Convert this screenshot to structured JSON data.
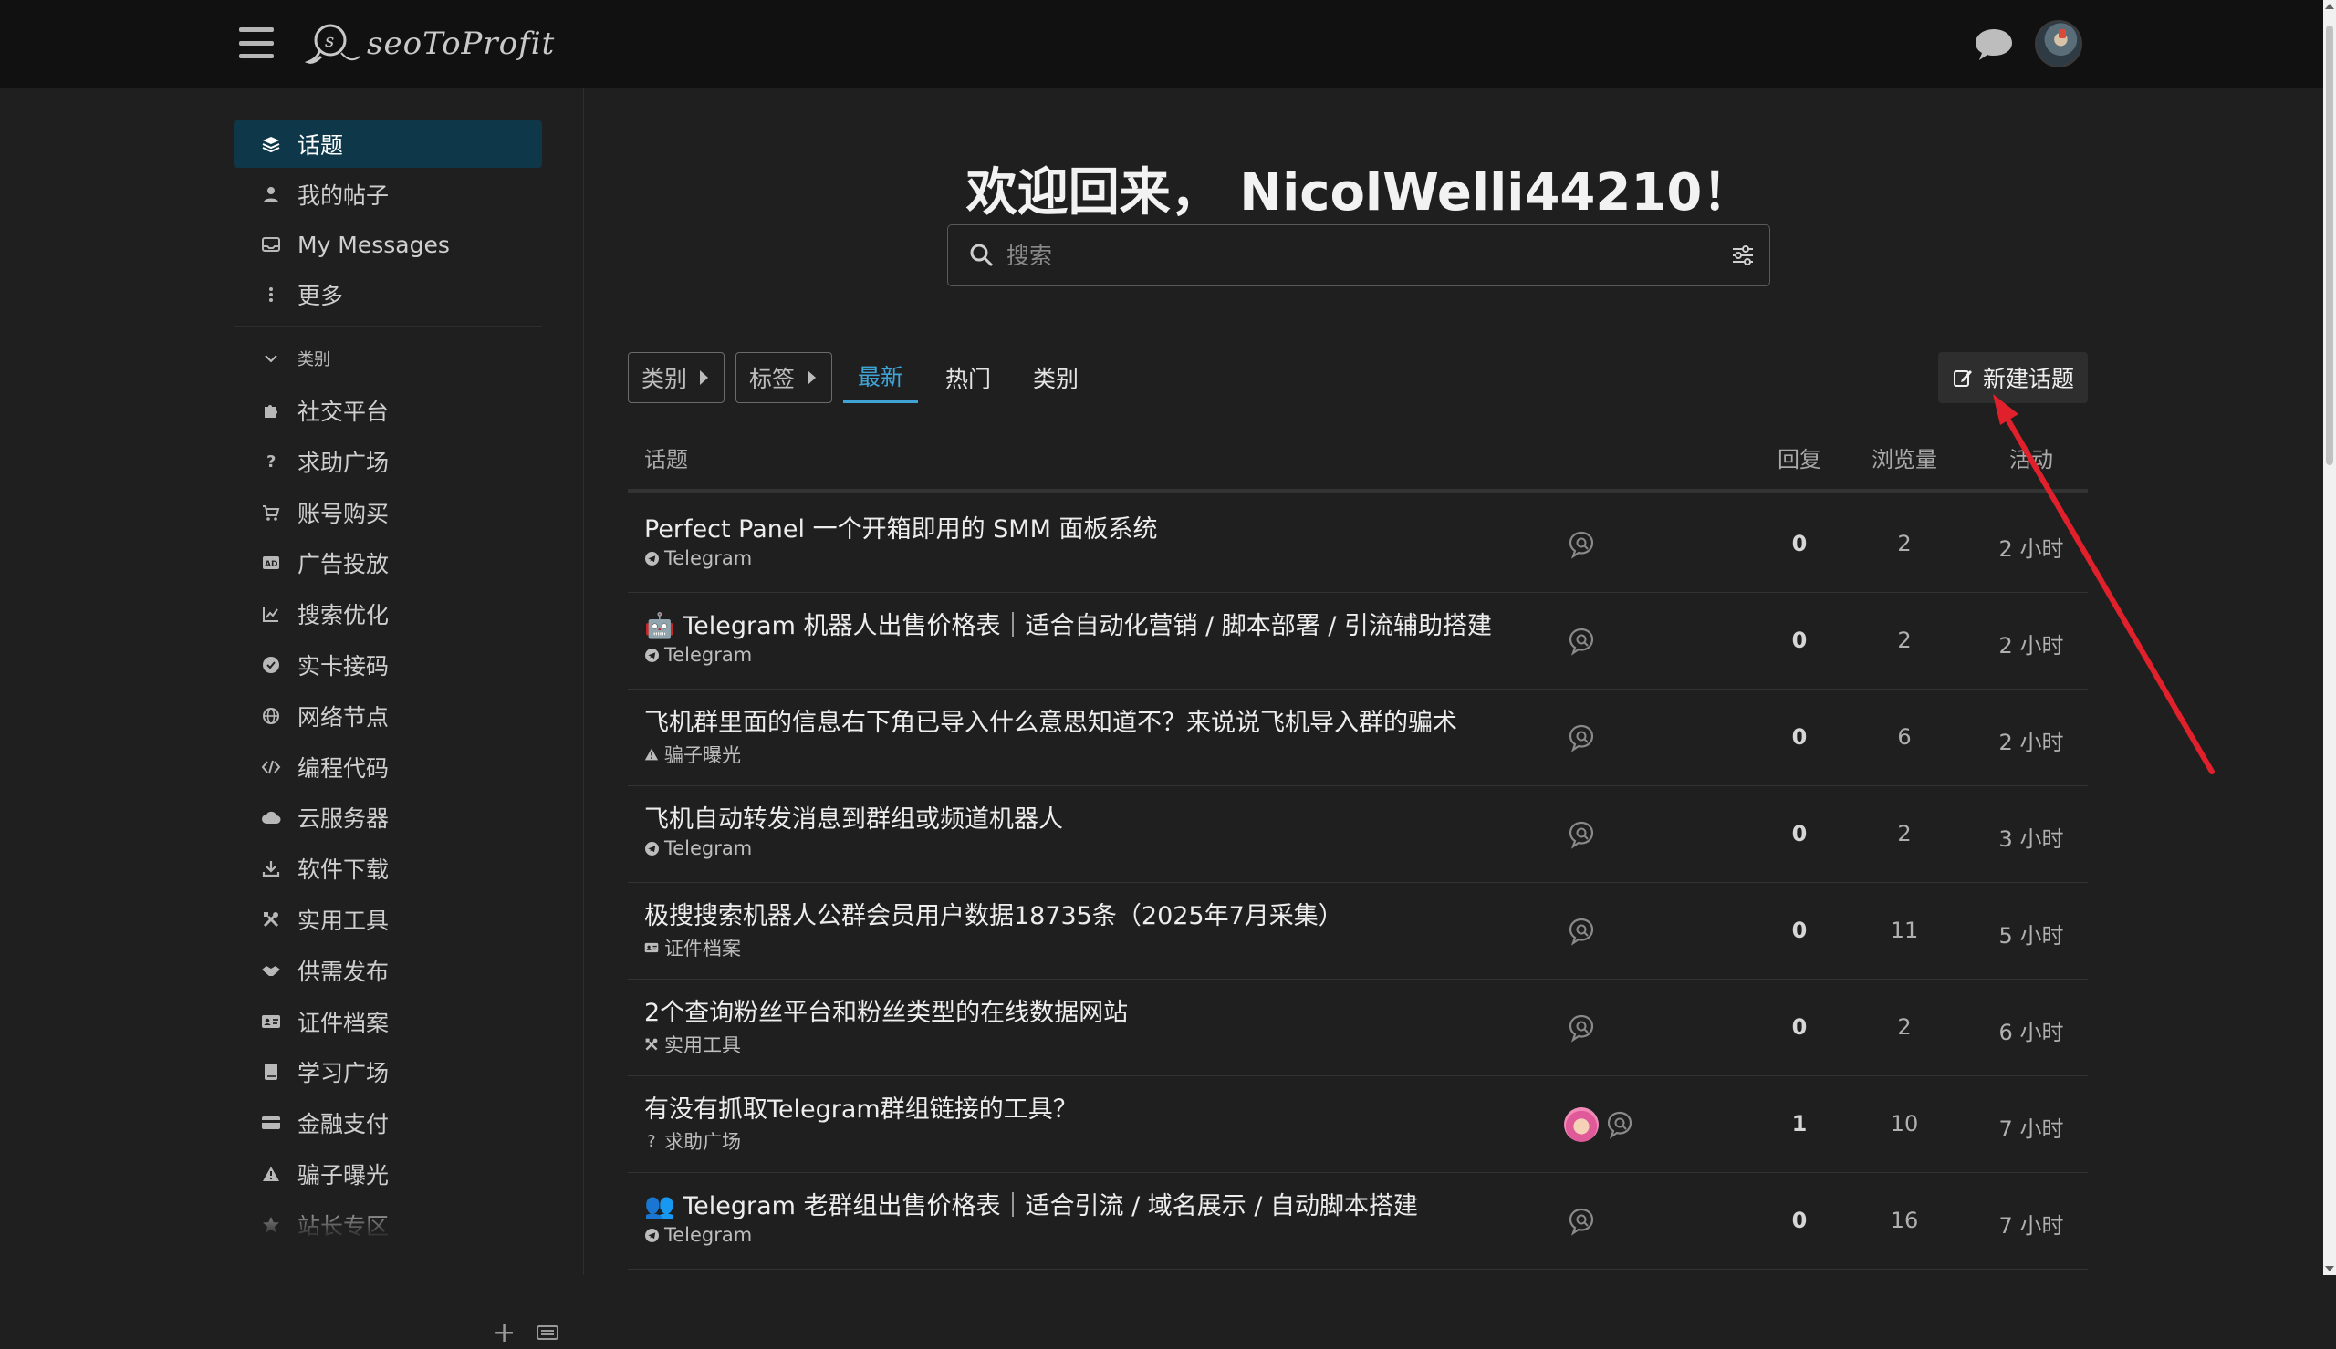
{
  "header": {
    "logo_text": "seoToProfit",
    "menu_icon": "hamburger-icon",
    "chat_icon": "chat-bubble-icon",
    "avatar": "user-avatar"
  },
  "sidebar": {
    "main_items": [
      {
        "label": "话题",
        "icon": "layers-icon",
        "active": true
      },
      {
        "label": "我的帖子",
        "icon": "user-icon"
      },
      {
        "label": "My Messages",
        "icon": "inbox-icon"
      },
      {
        "label": "更多",
        "icon": "more-vertical-icon"
      }
    ],
    "section_label": "类别",
    "categories": [
      {
        "label": "社交平台",
        "icon": "puzzle-icon"
      },
      {
        "label": "求助广场",
        "icon": "question-icon"
      },
      {
        "label": "账号购买",
        "icon": "cart-icon"
      },
      {
        "label": "广告投放",
        "icon": "ad-icon"
      },
      {
        "label": "搜索优化",
        "icon": "chart-line-icon"
      },
      {
        "label": "实卡接码",
        "icon": "check-circle-icon"
      },
      {
        "label": "网络节点",
        "icon": "globe-icon"
      },
      {
        "label": "编程代码",
        "icon": "code-icon"
      },
      {
        "label": "云服务器",
        "icon": "cloud-icon"
      },
      {
        "label": "软件下载",
        "icon": "download-icon"
      },
      {
        "label": "实用工具",
        "icon": "tools-icon"
      },
      {
        "label": "供需发布",
        "icon": "handshake-icon"
      },
      {
        "label": "证件档案",
        "icon": "id-card-icon"
      },
      {
        "label": "学习广场",
        "icon": "book-icon"
      },
      {
        "label": "金融支付",
        "icon": "credit-card-icon"
      },
      {
        "label": "骗子曝光",
        "icon": "warning-icon"
      },
      {
        "label": "站长专区",
        "icon": "star-icon"
      }
    ]
  },
  "main": {
    "welcome": "欢迎回来， NicolWelli44210！",
    "search_placeholder": "搜索",
    "filters": {
      "category_dropdown": "类别",
      "tag_dropdown": "标签"
    },
    "tabs": [
      {
        "label": "最新",
        "active": true
      },
      {
        "label": "热门"
      },
      {
        "label": "类别"
      }
    ],
    "new_topic_label": "新建话题",
    "columns": {
      "topic": "话题",
      "replies": "回复",
      "views": "浏览量",
      "activity": "活动"
    },
    "topics": [
      {
        "title": "Perfect Panel 一个开箱即用的 SMM 面板系统",
        "category": "Telegram",
        "cat_icon": "telegram-icon",
        "replies": "0",
        "views": "2",
        "activity": "2 小时"
      },
      {
        "title": "🤖 Telegram 机器人出售价格表｜适合自动化营销 / 脚本部署 / 引流辅助搭建",
        "category": "Telegram",
        "cat_icon": "telegram-icon",
        "replies": "0",
        "views": "2",
        "activity": "2 小时"
      },
      {
        "title": "飞机群里面的信息右下角已导入什么意思知道不？来说说飞机导入群的骗术",
        "category": "骗子曝光",
        "cat_icon": "warning-icon",
        "replies": "0",
        "views": "6",
        "activity": "2 小时"
      },
      {
        "title": "飞机自动转发消息到群组或频道机器人",
        "category": "Telegram",
        "cat_icon": "telegram-icon",
        "replies": "0",
        "views": "2",
        "activity": "3 小时"
      },
      {
        "title": "极搜搜索机器人公群会员用户数据18735条（2025年7月采集）",
        "category": "证件档案",
        "cat_icon": "id-card-icon",
        "replies": "0",
        "views": "11",
        "activity": "5 小时"
      },
      {
        "title": "2个查询粉丝平台和粉丝类型的在线数据网站",
        "category": "实用工具",
        "cat_icon": "tools-icon",
        "replies": "0",
        "views": "2",
        "activity": "6 小时"
      },
      {
        "title": "有没有抓取Telegram群组链接的工具？",
        "category": "求助广场",
        "cat_icon": "question-icon",
        "replies": "1",
        "views": "10",
        "activity": "7 小时",
        "has_avatar": true
      },
      {
        "title": "👥 Telegram 老群组出售价格表｜适合引流 / 域名展示 / 自动脚本搭建",
        "category": "Telegram",
        "cat_icon": "telegram-icon",
        "replies": "0",
        "views": "16",
        "activity": "7 小时"
      }
    ]
  },
  "colors": {
    "accent": "#3fa3d6",
    "active_bg": "#0e3849",
    "annotation": "#e0202a"
  }
}
